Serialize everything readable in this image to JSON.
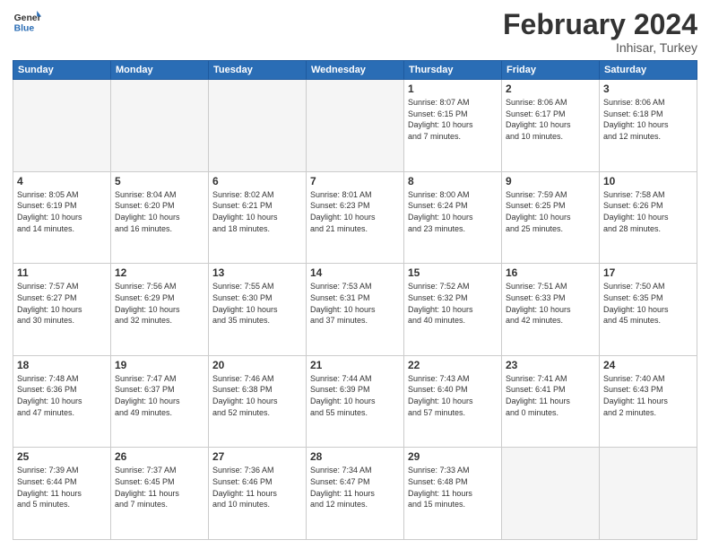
{
  "logo": {
    "line1": "General",
    "line2": "Blue"
  },
  "title": "February 2024",
  "subtitle": "Inhisar, Turkey",
  "days_of_week": [
    "Sunday",
    "Monday",
    "Tuesday",
    "Wednesday",
    "Thursday",
    "Friday",
    "Saturday"
  ],
  "weeks": [
    [
      {
        "day": "",
        "info": ""
      },
      {
        "day": "",
        "info": ""
      },
      {
        "day": "",
        "info": ""
      },
      {
        "day": "",
        "info": ""
      },
      {
        "day": "1",
        "info": "Sunrise: 8:07 AM\nSunset: 6:15 PM\nDaylight: 10 hours\nand 7 minutes."
      },
      {
        "day": "2",
        "info": "Sunrise: 8:06 AM\nSunset: 6:17 PM\nDaylight: 10 hours\nand 10 minutes."
      },
      {
        "day": "3",
        "info": "Sunrise: 8:06 AM\nSunset: 6:18 PM\nDaylight: 10 hours\nand 12 minutes."
      }
    ],
    [
      {
        "day": "4",
        "info": "Sunrise: 8:05 AM\nSunset: 6:19 PM\nDaylight: 10 hours\nand 14 minutes."
      },
      {
        "day": "5",
        "info": "Sunrise: 8:04 AM\nSunset: 6:20 PM\nDaylight: 10 hours\nand 16 minutes."
      },
      {
        "day": "6",
        "info": "Sunrise: 8:02 AM\nSunset: 6:21 PM\nDaylight: 10 hours\nand 18 minutes."
      },
      {
        "day": "7",
        "info": "Sunrise: 8:01 AM\nSunset: 6:23 PM\nDaylight: 10 hours\nand 21 minutes."
      },
      {
        "day": "8",
        "info": "Sunrise: 8:00 AM\nSunset: 6:24 PM\nDaylight: 10 hours\nand 23 minutes."
      },
      {
        "day": "9",
        "info": "Sunrise: 7:59 AM\nSunset: 6:25 PM\nDaylight: 10 hours\nand 25 minutes."
      },
      {
        "day": "10",
        "info": "Sunrise: 7:58 AM\nSunset: 6:26 PM\nDaylight: 10 hours\nand 28 minutes."
      }
    ],
    [
      {
        "day": "11",
        "info": "Sunrise: 7:57 AM\nSunset: 6:27 PM\nDaylight: 10 hours\nand 30 minutes."
      },
      {
        "day": "12",
        "info": "Sunrise: 7:56 AM\nSunset: 6:29 PM\nDaylight: 10 hours\nand 32 minutes."
      },
      {
        "day": "13",
        "info": "Sunrise: 7:55 AM\nSunset: 6:30 PM\nDaylight: 10 hours\nand 35 minutes."
      },
      {
        "day": "14",
        "info": "Sunrise: 7:53 AM\nSunset: 6:31 PM\nDaylight: 10 hours\nand 37 minutes."
      },
      {
        "day": "15",
        "info": "Sunrise: 7:52 AM\nSunset: 6:32 PM\nDaylight: 10 hours\nand 40 minutes."
      },
      {
        "day": "16",
        "info": "Sunrise: 7:51 AM\nSunset: 6:33 PM\nDaylight: 10 hours\nand 42 minutes."
      },
      {
        "day": "17",
        "info": "Sunrise: 7:50 AM\nSunset: 6:35 PM\nDaylight: 10 hours\nand 45 minutes."
      }
    ],
    [
      {
        "day": "18",
        "info": "Sunrise: 7:48 AM\nSunset: 6:36 PM\nDaylight: 10 hours\nand 47 minutes."
      },
      {
        "day": "19",
        "info": "Sunrise: 7:47 AM\nSunset: 6:37 PM\nDaylight: 10 hours\nand 49 minutes."
      },
      {
        "day": "20",
        "info": "Sunrise: 7:46 AM\nSunset: 6:38 PM\nDaylight: 10 hours\nand 52 minutes."
      },
      {
        "day": "21",
        "info": "Sunrise: 7:44 AM\nSunset: 6:39 PM\nDaylight: 10 hours\nand 55 minutes."
      },
      {
        "day": "22",
        "info": "Sunrise: 7:43 AM\nSunset: 6:40 PM\nDaylight: 10 hours\nand 57 minutes."
      },
      {
        "day": "23",
        "info": "Sunrise: 7:41 AM\nSunset: 6:41 PM\nDaylight: 11 hours\nand 0 minutes."
      },
      {
        "day": "24",
        "info": "Sunrise: 7:40 AM\nSunset: 6:43 PM\nDaylight: 11 hours\nand 2 minutes."
      }
    ],
    [
      {
        "day": "25",
        "info": "Sunrise: 7:39 AM\nSunset: 6:44 PM\nDaylight: 11 hours\nand 5 minutes."
      },
      {
        "day": "26",
        "info": "Sunrise: 7:37 AM\nSunset: 6:45 PM\nDaylight: 11 hours\nand 7 minutes."
      },
      {
        "day": "27",
        "info": "Sunrise: 7:36 AM\nSunset: 6:46 PM\nDaylight: 11 hours\nand 10 minutes."
      },
      {
        "day": "28",
        "info": "Sunrise: 7:34 AM\nSunset: 6:47 PM\nDaylight: 11 hours\nand 12 minutes."
      },
      {
        "day": "29",
        "info": "Sunrise: 7:33 AM\nSunset: 6:48 PM\nDaylight: 11 hours\nand 15 minutes."
      },
      {
        "day": "",
        "info": ""
      },
      {
        "day": "",
        "info": ""
      }
    ]
  ]
}
